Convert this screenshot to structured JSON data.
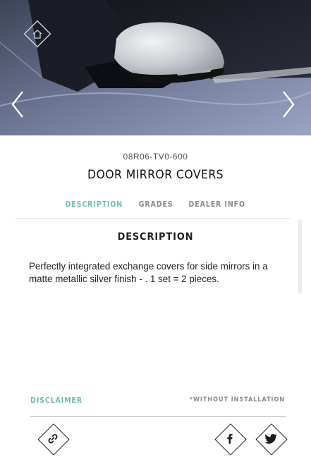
{
  "hero": {
    "image_alt": "",
    "icons": {
      "home": "home-icon",
      "previous": "chevron-left-icon",
      "next": "chevron-right-icon"
    }
  },
  "product": {
    "part_number": "08R06-TV0-600",
    "title": "DOOR MIRROR COVERS"
  },
  "tabs": [
    {
      "label": "DESCRIPTION",
      "active": true
    },
    {
      "label": "GRADES",
      "active": false
    },
    {
      "label": "DEALER INFO",
      "active": false
    }
  ],
  "content": {
    "heading": "DESCRIPTION",
    "body": "Perfectly integrated exchange covers for side mirrors in a matte metallic silver finish - . 1 set = 2 pieces."
  },
  "footer": {
    "disclaimer_label": "DISCLAIMER",
    "installation_note": "*WITHOUT INSTALLATION",
    "share_icons": [
      "link-icon",
      "facebook-icon",
      "twitter-icon"
    ]
  },
  "colors": {
    "accent": "#6cc2a6",
    "muted": "#8a8a8a",
    "text": "#222222"
  }
}
